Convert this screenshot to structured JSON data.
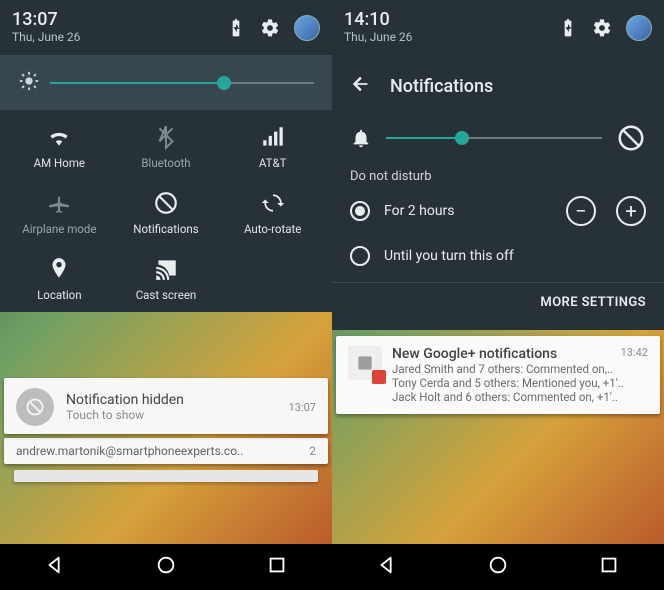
{
  "left": {
    "status": {
      "time": "13:07",
      "date": "Thu, June 26"
    },
    "brightness_pct": 66,
    "tiles": [
      {
        "name": "wifi",
        "label": "AM Home",
        "dim": false
      },
      {
        "name": "bt",
        "label": "Bluetooth",
        "dim": true
      },
      {
        "name": "cell",
        "label": "AT&T",
        "dim": false
      },
      {
        "name": "plane",
        "label": "Airplane mode",
        "dim": true
      },
      {
        "name": "notif",
        "label": "Notifications",
        "dim": false
      },
      {
        "name": "rotate",
        "label": "Auto-rotate",
        "dim": false
      },
      {
        "name": "loc",
        "label": "Location",
        "dim": false
      },
      {
        "name": "cast",
        "label": "Cast screen",
        "dim": false
      }
    ],
    "hidden_card": {
      "title": "Notification hidden",
      "subtitle": "Touch to show",
      "time": "13:07"
    },
    "peek_line": "andrew.martonik@smartphoneexperts.co..",
    "peek_count": "2"
  },
  "right": {
    "status": {
      "time": "14:10",
      "date": "Thu, June 26"
    },
    "title": "Notifications",
    "volume_pct": 35,
    "section_label": "Do not disturb",
    "options": [
      {
        "label": "For 2 hours",
        "selected": true,
        "stepper": true
      },
      {
        "label": "Until you turn this off",
        "selected": false,
        "stepper": false
      }
    ],
    "more": "MORE SETTINGS",
    "gplus": {
      "title": "New Google+ notifications",
      "time": "13:42",
      "lines": [
        "Jared Smith and 7 others: Commented on,..",
        "Tony Cerda and 5 others: Mentioned you, +1'..",
        "Jack Holt and 6 others: Commented on, +1'.."
      ]
    }
  }
}
